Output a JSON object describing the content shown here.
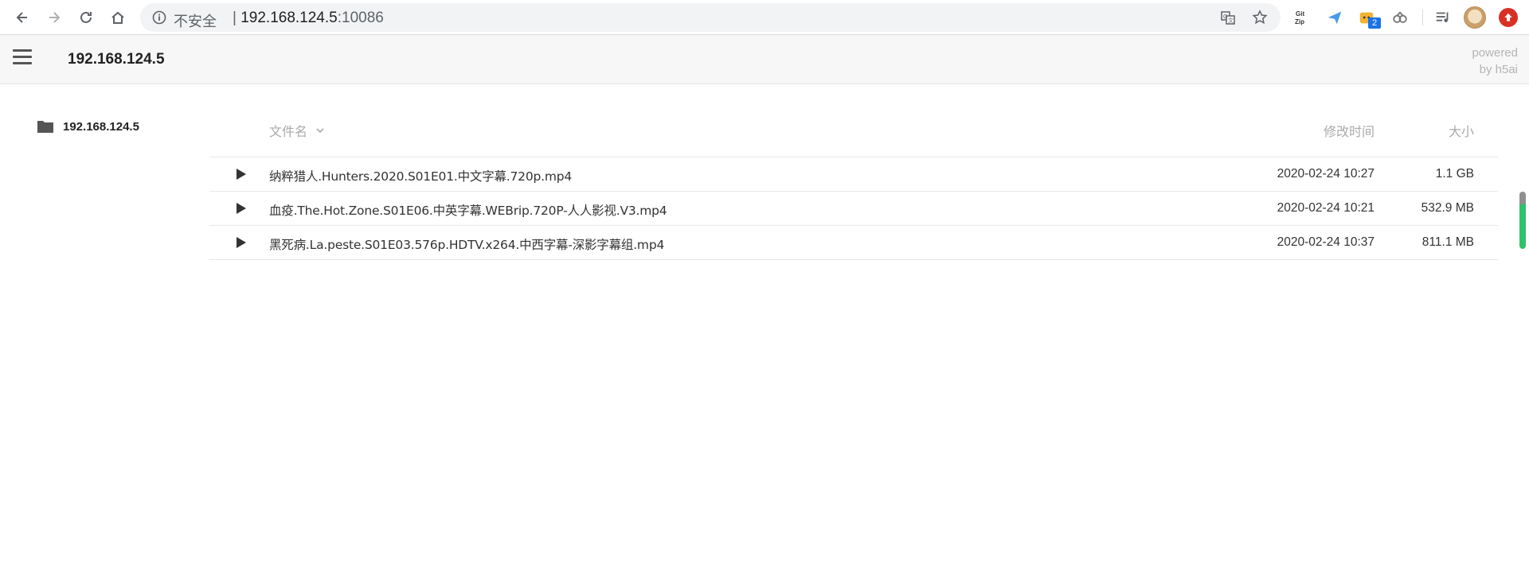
{
  "browser": {
    "security_text": "不安全",
    "url_host": "192.168.124.5",
    "url_port": ":10086",
    "extension_badge": "2"
  },
  "header": {
    "title": "192.168.124.5",
    "powered_line1": "powered",
    "powered_line2": "by h5ai"
  },
  "sidebar": {
    "root_label": "192.168.124.5"
  },
  "list": {
    "col_name": "文件名",
    "col_date": "修改时间",
    "col_size": "大小",
    "rows": [
      {
        "name": "纳粹猎人.Hunters.2020.S01E01.中文字幕.720p.mp4",
        "date": "2020-02-24 10:27",
        "size": "1.1 GB"
      },
      {
        "name": "血疫.The.Hot.Zone.S01E06.中英字幕.WEBrip.720P-人人影视.V3.mp4",
        "date": "2020-02-24 10:21",
        "size": "532.9 MB"
      },
      {
        "name": "黑死病.La.peste.S01E03.576p.HDTV.x264.中西字幕-深影字幕组.mp4",
        "date": "2020-02-24 10:37",
        "size": "811.1 MB"
      }
    ]
  },
  "colors": {
    "accent_update": "#d93025",
    "badge_blue": "#1a73e8"
  }
}
